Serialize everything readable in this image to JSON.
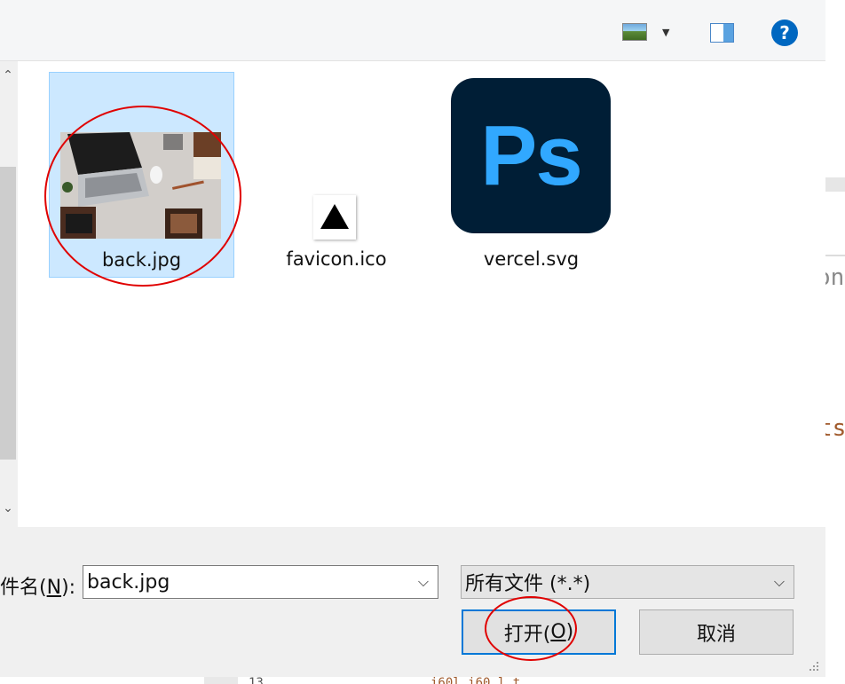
{
  "files": [
    {
      "name": "back.jpg",
      "selected": true,
      "icon": "photo-thumbnail"
    },
    {
      "name": "favicon.ico",
      "selected": false,
      "icon": "triangle-icon"
    },
    {
      "name": "vercel.svg",
      "selected": false,
      "icon": "photoshop-icon"
    }
  ],
  "ps_icon_text": "Ps",
  "toolbar": {
    "help_glyph": "?"
  },
  "filename": {
    "label_prefix": "件名(",
    "label_mnemonic": "N",
    "label_suffix": "):",
    "value": "back.jpg"
  },
  "filetype": {
    "value": "所有文件 (*.*)"
  },
  "buttons": {
    "open_prefix": "打开(",
    "open_mnemonic": "O",
    "open_suffix": ")",
    "cancel": "取消"
  },
  "background": {
    "text1": "on",
    "text2": "ts",
    "text3": "13",
    "text4": "i60l.i60 l.t"
  },
  "colors": {
    "selection_bg": "#cce8ff",
    "selection_border": "#99d1ff",
    "ps_bg": "#001e36",
    "ps_fg": "#31a8ff",
    "help_blue": "#0067c0",
    "annotation_red": "#e00000"
  }
}
